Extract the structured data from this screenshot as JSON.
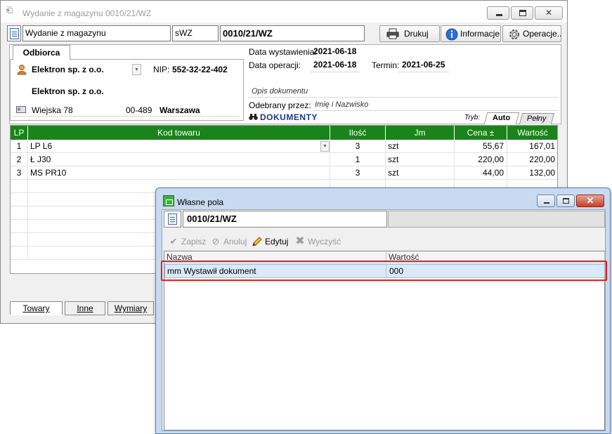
{
  "main_window": {
    "title": "Wydanie z magazynu 0010/21/WZ",
    "toolbar": {
      "doc_type": "Wydanie z magazynu",
      "series": "sWZ",
      "doc_number": "0010/21/WZ",
      "print_label": "Drukuj",
      "info_label": "Informacje",
      "operations_label": "Operacje.."
    },
    "recipient": {
      "tab_label": "Odbiorca",
      "name": "Elektron sp. z o.o.",
      "nip_label": "NIP:",
      "nip": "552-32-22-402",
      "name2": "Elektron sp. z o.o.",
      "street": "Wiejska 78",
      "postal_code": "00-489",
      "city": "Warszawa"
    },
    "dates": {
      "issue_label": "Data wystawienia:",
      "issue_date": "2021-06-18",
      "operation_label": "Data operacji:",
      "operation_date": "2021-06-18",
      "term_label": "Termin:",
      "term_date": "2021-06-25"
    },
    "description_placeholder": "Opis dokumentu",
    "received_label": "Odebrany przez:",
    "received_value": "Imię i Nazwisko",
    "documents_label": "DOKUMENTY",
    "mode_label": "Tryb:",
    "mode_tabs": [
      "Auto",
      "Pełny"
    ],
    "grid": {
      "columns": [
        "LP",
        "Kod towaru",
        "Ilość",
        "Jm",
        "Cena ±",
        "Wartość"
      ],
      "rows": [
        {
          "lp": "1",
          "code": "LP L6",
          "qty": "3",
          "unit": "szt",
          "price": "55,67",
          "value": "167,01"
        },
        {
          "lp": "2",
          "code": "Ł J30",
          "qty": "1",
          "unit": "szt",
          "price": "220,00",
          "value": "220,00"
        },
        {
          "lp": "3",
          "code": "MS PR10",
          "qty": "3",
          "unit": "szt",
          "price": "44,00",
          "value": "132,00"
        }
      ]
    },
    "bottom_tabs": [
      "Towary",
      "Inne",
      "Wymiary"
    ]
  },
  "popup": {
    "title": "Własne pola",
    "doc_number": "0010/21/WZ",
    "tools": {
      "save": "Zapisz",
      "cancel": "Anuluj",
      "edit": "Edytuj",
      "clear": "Wyczyść"
    },
    "grid": {
      "columns": [
        "Nazwa",
        "Wartość"
      ],
      "rows": [
        {
          "name": "mm Wystawił dokument",
          "value": "000"
        }
      ]
    }
  },
  "colors": {
    "grid_header": "#1a841a",
    "highlight": "#e0201c",
    "popup_frame": "#c7daf0"
  }
}
